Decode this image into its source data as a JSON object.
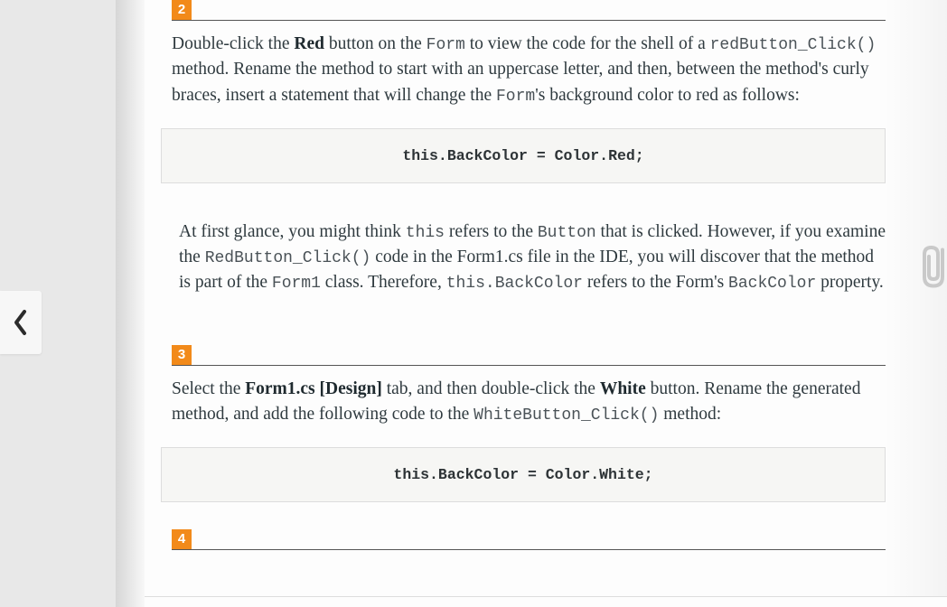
{
  "nav": {
    "prev_icon": "chevron-left"
  },
  "attach_icon": "paperclip",
  "steps": {
    "s2": {
      "num": "2",
      "p": {
        "t1": "Double-click the ",
        "b1": "Red",
        "t2": " button on the ",
        "c1": "Form",
        "t3": " to view the code for the shell of a ",
        "c2": "redButton_Click()",
        "t4": " method. Rename the method to start with an uppercase letter, and then, between the method's curly braces, insert a statement that will change the ",
        "c3": "Form",
        "t5": "'s background color to red as follows:"
      },
      "code": "this.BackColor = Color.Red;"
    },
    "note": {
      "t1": "At first glance, you might think ",
      "c1": "this",
      "t2": " refers to the ",
      "c2": "Button",
      "t3": " that is clicked. However, if you examine the ",
      "c3": "RedButton_Click()",
      "t4": " code in the Form1.cs file in the IDE, you will discover that the method is part of the ",
      "c4": "Form1",
      "t5": " class. Therefore, ",
      "c5": "this.BackColor",
      "t6": " refers to the Form's ",
      "c6": "BackColor",
      "t7": " property."
    },
    "s3": {
      "num": "3",
      "p": {
        "t1": "Select the ",
        "b1": "Form1.cs [Design]",
        "t2": " tab, and then double-click the ",
        "b2": "White",
        "t3": " button. Rename the generated method, and add the following code to the ",
        "c1": "WhiteButton_Click()",
        "t4": " method:"
      },
      "code": "this.BackColor = Color.White;"
    },
    "s4": {
      "num": "4"
    }
  }
}
